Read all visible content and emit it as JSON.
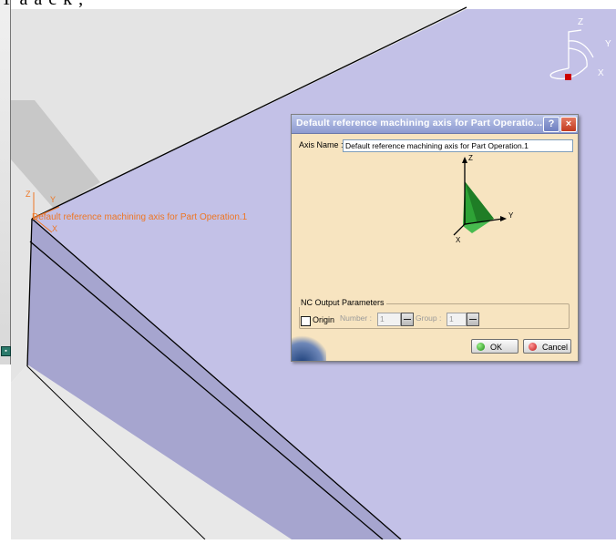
{
  "top_partial_text": "Ŷ a a c k ,",
  "axis_overlay": {
    "label": "Default reference machining axis for Part Operation.1",
    "x_letter": "X",
    "y_letter": "Y",
    "z_letter": "Z"
  },
  "compass": {
    "x": "X",
    "y": "Y",
    "z": "Z"
  },
  "dialog": {
    "title": "Default reference machining axis for Part Operatio...",
    "help_label": "?",
    "close_label": "×",
    "axis_name_label": "Axis Name :",
    "axis_name_value": "Default reference machining axis for Part Operation.1",
    "preview_axes": {
      "z": "Z",
      "y": "Y",
      "x": "X"
    },
    "nc_group_title": "NC Output Parameters",
    "origin_label": "Origin",
    "number_label": "Number :",
    "number_value": "1",
    "group_label": "Group :",
    "group_value": "1",
    "ok_label": "OK",
    "cancel_label": "Cancel"
  },
  "colors": {
    "dialog_bg": "#f7e4c0",
    "part_top": "#c3c1e7",
    "part_side": "#a6a5cf",
    "axis_label": "#ee7624",
    "preview_green": "#2ea336"
  }
}
